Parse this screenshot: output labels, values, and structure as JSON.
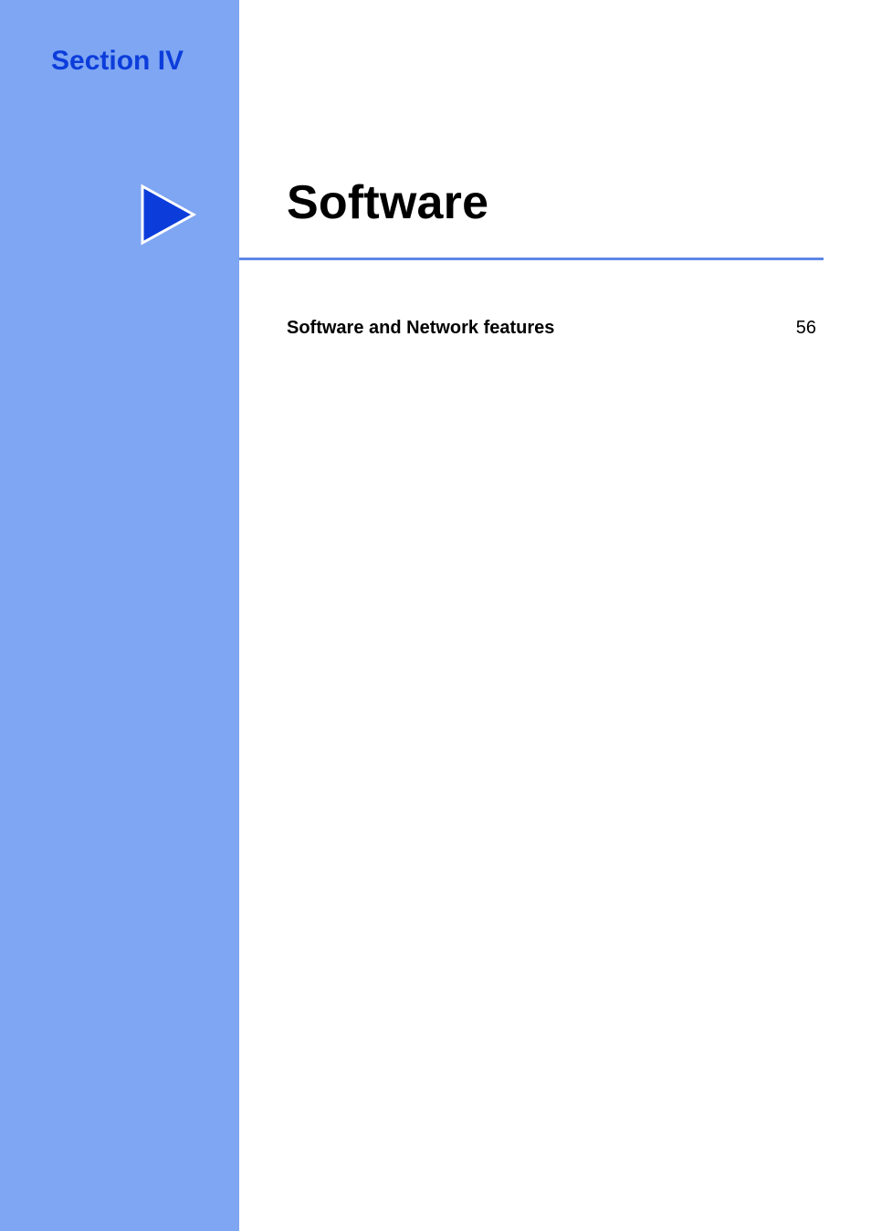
{
  "document": {
    "section_label": "Section IV",
    "title": "Software",
    "toc": [
      {
        "label": "Software and Network features",
        "page": "56"
      }
    ],
    "colors": {
      "sidebar": "#7fa6f2",
      "section_label": "#0c3ddb",
      "marker_fill": "#0c3ddb",
      "underline": "#5d87e8"
    }
  }
}
